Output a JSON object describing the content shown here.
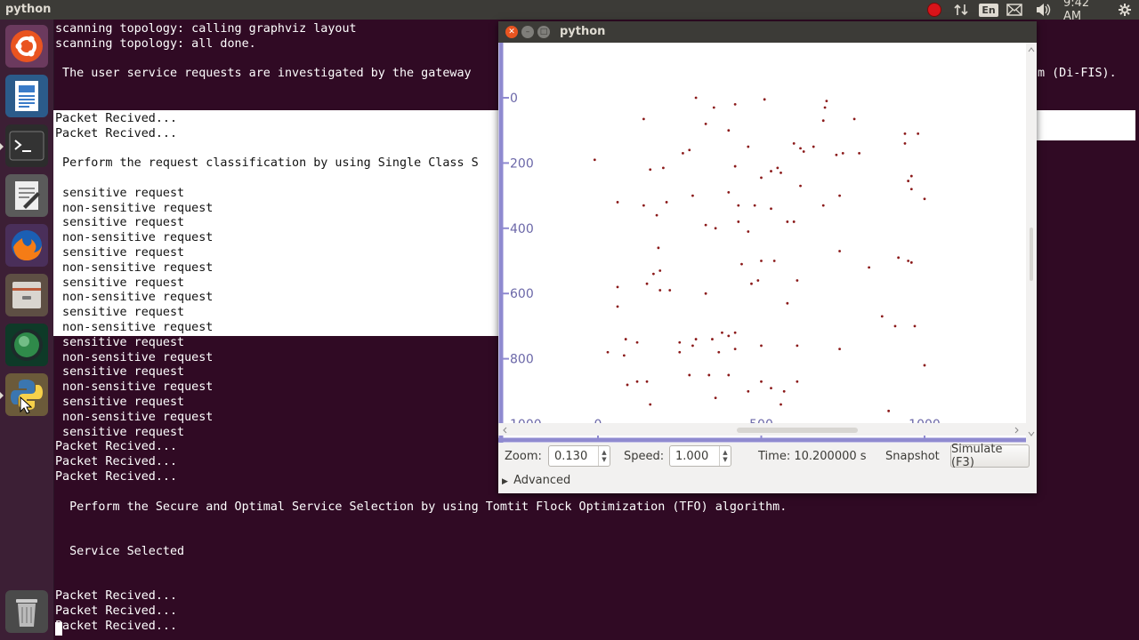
{
  "topbar": {
    "app_title": "python",
    "language": "En",
    "clock": "9:42 AM",
    "icons": [
      "record-indicator-icon",
      "network-arrows-icon",
      "keyboard-language-icon",
      "mail-icon",
      "volume-icon",
      "system-gear-icon"
    ]
  },
  "launcher": {
    "items": [
      "ubuntu-dash-icon",
      "writer-document-icon",
      "terminal-icon",
      "text-editor-icon",
      "firefox-icon",
      "files-cabinet-icon",
      "globe-app-icon",
      "python-icon",
      "trash-icon"
    ]
  },
  "terminal": {
    "lines": [
      {
        "text": "scanning topology: calling graphviz layout",
        "style": "normal"
      },
      {
        "text": "scanning topology: all done.",
        "style": "normal"
      },
      {
        "text": "",
        "style": "normal"
      },
      {
        "text": " The user service requests are investigated by the gateway",
        "tail": "m (Di-FIS).",
        "style": "normal"
      },
      {
        "text": "",
        "style": "normal"
      },
      {
        "text": "",
        "style": "hl"
      },
      {
        "text": "Packet Recived...",
        "style": "hl"
      },
      {
        "text": "Packet Recived...",
        "style": "hl"
      },
      {
        "text": "",
        "style": "hl"
      },
      {
        "text": " Perform the request classification by using Single Class S",
        "style": "hl"
      },
      {
        "text": "",
        "style": "hl"
      },
      {
        "text": " sensitive request",
        "style": "hl"
      },
      {
        "text": " non-sensitive request",
        "style": "hl"
      },
      {
        "text": " sensitive request",
        "style": "hl"
      },
      {
        "text": " non-sensitive request",
        "style": "hl"
      },
      {
        "text": " sensitive request",
        "style": "hl"
      },
      {
        "text": " non-sensitive request",
        "style": "hl"
      },
      {
        "text": " sensitive request",
        "style": "hl"
      },
      {
        "text": " non-sensitive request",
        "style": "hl"
      },
      {
        "text": " sensitive request",
        "style": "hl"
      },
      {
        "text": " non-sensitive request",
        "style": "hl"
      },
      {
        "text": " sensitive request",
        "style": "normal"
      },
      {
        "text": " non-sensitive request",
        "style": "normal"
      },
      {
        "text": " sensitive request",
        "style": "normal"
      },
      {
        "text": " non-sensitive request",
        "style": "normal"
      },
      {
        "text": " sensitive request",
        "style": "normal"
      },
      {
        "text": " non-sensitive request",
        "style": "normal"
      },
      {
        "text": " sensitive request",
        "style": "normal"
      },
      {
        "text": "Packet Recived...",
        "style": "normal"
      },
      {
        "text": "Packet Recived...",
        "style": "normal"
      },
      {
        "text": "Packet Recived...",
        "style": "normal"
      },
      {
        "text": "",
        "style": "normal"
      },
      {
        "text": "  Perform the Secure and Optimal Service Selection by using Tomtit Flock Optimization (TFO) algorithm.",
        "style": "normal"
      },
      {
        "text": "",
        "style": "normal"
      },
      {
        "text": "",
        "style": "normal"
      },
      {
        "text": "  Service Selected",
        "style": "normal"
      },
      {
        "text": "",
        "style": "normal"
      },
      {
        "text": "",
        "style": "normal"
      },
      {
        "text": "Packet Recived...",
        "style": "normal"
      },
      {
        "text": "Packet Recived...",
        "style": "normal"
      },
      {
        "text": "Packet Recived...",
        "style": "normal"
      }
    ]
  },
  "pywindow": {
    "title": "python",
    "controls": {
      "zoom_label": "Zoom:",
      "zoom_value": "0.130",
      "speed_label": "Speed:",
      "speed_value": "1.000",
      "time_text": "Time: 10.200000 s",
      "snapshot_label": "Snapshot",
      "simulate_label": "Simulate (F3)",
      "advanced_label": "Advanced"
    },
    "colors": {
      "node": "#8b1a1a",
      "ruler": "#8f8ad0",
      "ruler_text": "#6b67a8"
    }
  },
  "chart_data": {
    "type": "scatter",
    "x_ticks": [
      "0",
      "500",
      "1000"
    ],
    "y_ticks": [
      "0",
      "200",
      "400",
      "600",
      "800",
      "1000"
    ],
    "xlim": [
      0,
      1000
    ],
    "ylim": [
      0,
      1000
    ],
    "y_inverted": true,
    "points": [
      [
        300,
        0
      ],
      [
        355,
        30
      ],
      [
        420,
        20
      ],
      [
        510,
        5
      ],
      [
        700,
        10
      ],
      [
        695,
        30
      ],
      [
        140,
        65
      ],
      [
        330,
        80
      ],
      [
        400,
        100
      ],
      [
        690,
        70
      ],
      [
        785,
        65
      ],
      [
        460,
        150
      ],
      [
        600,
        140
      ],
      [
        620,
        155
      ],
      [
        630,
        165
      ],
      [
        660,
        150
      ],
      [
        750,
        170
      ],
      [
        730,
        175
      ],
      [
        800,
        170
      ],
      [
        940,
        110
      ],
      [
        980,
        110
      ],
      [
        940,
        140
      ],
      [
        260,
        170
      ],
      [
        280,
        160
      ],
      [
        420,
        210
      ],
      [
        530,
        225
      ],
      [
        550,
        215
      ],
      [
        560,
        230
      ],
      [
        160,
        220
      ],
      [
        200,
        215
      ],
      [
        500,
        245
      ],
      [
        620,
        270
      ],
      [
        960,
        240
      ],
      [
        950,
        255
      ],
      [
        -10,
        190
      ],
      [
        60,
        320
      ],
      [
        140,
        330
      ],
      [
        180,
        360
      ],
      [
        210,
        320
      ],
      [
        290,
        300
      ],
      [
        400,
        290
      ],
      [
        430,
        330
      ],
      [
        480,
        330
      ],
      [
        530,
        340
      ],
      [
        740,
        300
      ],
      [
        690,
        330
      ],
      [
        960,
        280
      ],
      [
        1000,
        310
      ],
      [
        330,
        390
      ],
      [
        360,
        400
      ],
      [
        430,
        380
      ],
      [
        460,
        410
      ],
      [
        580,
        380
      ],
      [
        600,
        380
      ],
      [
        185,
        460
      ],
      [
        440,
        510
      ],
      [
        500,
        500
      ],
      [
        540,
        500
      ],
      [
        830,
        520
      ],
      [
        920,
        490
      ],
      [
        950,
        500
      ],
      [
        960,
        505
      ],
      [
        170,
        540
      ],
      [
        150,
        570
      ],
      [
        190,
        530
      ],
      [
        190,
        590
      ],
      [
        220,
        590
      ],
      [
        330,
        600
      ],
      [
        470,
        570
      ],
      [
        490,
        560
      ],
      [
        610,
        560
      ],
      [
        60,
        580
      ],
      [
        60,
        640
      ],
      [
        740,
        470
      ],
      [
        580,
        630
      ],
      [
        870,
        670
      ],
      [
        910,
        700
      ],
      [
        970,
        700
      ],
      [
        85,
        740
      ],
      [
        120,
        750
      ],
      [
        250,
        750
      ],
      [
        290,
        760
      ],
      [
        300,
        740
      ],
      [
        350,
        740
      ],
      [
        380,
        720
      ],
      [
        400,
        730
      ],
      [
        420,
        720
      ],
      [
        500,
        760
      ],
      [
        740,
        770
      ],
      [
        30,
        780
      ],
      [
        80,
        790
      ],
      [
        250,
        780
      ],
      [
        370,
        780
      ],
      [
        420,
        770
      ],
      [
        610,
        760
      ],
      [
        1000,
        820
      ],
      [
        90,
        880
      ],
      [
        120,
        870
      ],
      [
        150,
        870
      ],
      [
        280,
        850
      ],
      [
        400,
        850
      ],
      [
        340,
        850
      ],
      [
        500,
        870
      ],
      [
        530,
        890
      ],
      [
        570,
        900
      ],
      [
        610,
        870
      ],
      [
        460,
        900
      ],
      [
        360,
        920
      ],
      [
        160,
        940
      ],
      [
        560,
        940
      ],
      [
        890,
        960
      ]
    ]
  }
}
